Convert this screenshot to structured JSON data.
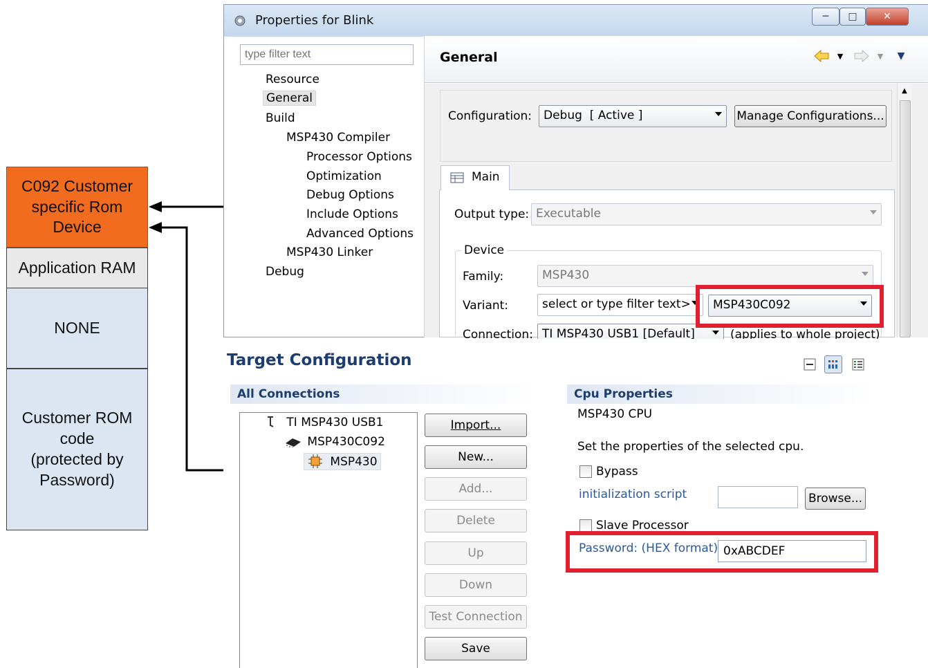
{
  "memory_map": {
    "blocks": [
      {
        "label": "C092 Customer\nspecific Rom\nDevice",
        "color": "#f26c1f"
      },
      {
        "label": "Application RAM",
        "color": "#e9e9e9"
      },
      {
        "label": "NONE",
        "color": "#dce6f2"
      },
      {
        "label": "Customer ROM\ncode\n(protected by\nPassword)",
        "color": "#dce6f2"
      }
    ]
  },
  "properties_window": {
    "title": "Properties for Blink",
    "filter_placeholder": "type filter text",
    "tree": [
      {
        "label": "Resource",
        "level": 0
      },
      {
        "label": "General",
        "level": 0,
        "selected": true
      },
      {
        "label": "Build",
        "level": 0
      },
      {
        "label": "MSP430 Compiler",
        "level": 1
      },
      {
        "label": "Processor Options",
        "level": 2
      },
      {
        "label": "Optimization",
        "level": 2
      },
      {
        "label": "Debug Options",
        "level": 2
      },
      {
        "label": "Include Options",
        "level": 2
      },
      {
        "label": "Advanced Options",
        "level": 2
      },
      {
        "label": "MSP430 Linker",
        "level": 1
      },
      {
        "label": "Debug",
        "level": 0
      }
    ],
    "page_title": "General",
    "configuration_label": "Configuration:",
    "configuration_value": "Debug  [ Active ]",
    "manage_button": "Manage Configurations...",
    "tab_main": "Main",
    "output_type_label": "Output type:",
    "output_type_value": "Executable",
    "device_group": "Device",
    "family_label": "Family:",
    "family_value": "MSP430",
    "variant_label": "Variant:",
    "variant_filter": "select or type filter text>",
    "variant_value": "MSP430C092",
    "connection_label": "Connection:",
    "connection_value": "TI MSP430 USB1 [Default]",
    "connection_note": "(applies to whole project)"
  },
  "target_config": {
    "title": "Target Configuration",
    "all_connections": "All Connections",
    "tree": [
      {
        "label": "TI MSP430 USB1",
        "icon": "probe-icon"
      },
      {
        "label": "MSP430C092",
        "icon": "chip-icon"
      },
      {
        "label": "MSP430",
        "icon": "cpu-icon"
      }
    ],
    "buttons": [
      {
        "label": "Import...",
        "enabled": true
      },
      {
        "label": "New...",
        "enabled": true
      },
      {
        "label": "Add...",
        "enabled": false
      },
      {
        "label": "Delete",
        "enabled": false
      },
      {
        "label": "Up",
        "enabled": false
      },
      {
        "label": "Down",
        "enabled": false
      },
      {
        "label": "Test Connection",
        "enabled": false
      },
      {
        "label": "Save",
        "enabled": true
      }
    ],
    "cpu_properties": "Cpu Properties",
    "cpu_name": "MSP430 CPU",
    "instructions": "Set the properties of the selected cpu.",
    "bypass_label": "Bypass",
    "init_script_label": "initialization script",
    "init_script_value": "",
    "browse_button": "Browse...",
    "slave_label": "Slave Processor",
    "password_label": "Password: (HEX format)",
    "password_value": "0xABCDEF"
  },
  "colors": {
    "highlight": "#e0202e",
    "rom_block": "#f26c1f",
    "header_text": "#1d3d70"
  }
}
